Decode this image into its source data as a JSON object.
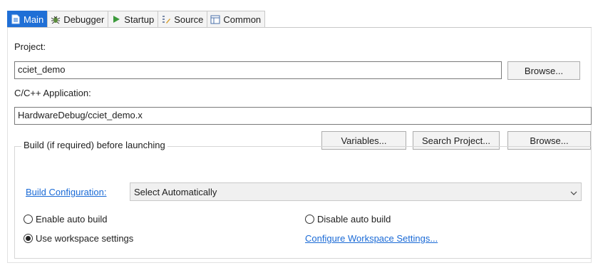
{
  "tabs": [
    {
      "label": "Main",
      "icon": "main-page-icon",
      "active": true
    },
    {
      "label": "Debugger",
      "icon": "debugger-bug-icon",
      "active": false
    },
    {
      "label": "Startup",
      "icon": "startup-play-icon",
      "active": false
    },
    {
      "label": "Source",
      "icon": "source-lookup-icon",
      "active": false
    },
    {
      "label": "Common",
      "icon": "common-window-icon",
      "active": false
    }
  ],
  "project": {
    "label": "Project:",
    "value": "cciet_demo",
    "browse_label": "Browse..."
  },
  "application": {
    "label": "C/C++ Application:",
    "value": "HardwareDebug/cciet_demo.x",
    "variables_label": "Variables...",
    "search_label": "Search Project...",
    "browse_label": "Browse..."
  },
  "build": {
    "group_title": "Build (if required) before launching",
    "config_link": "Build Configuration:",
    "config_value": "Select Automatically",
    "enable_auto": "Enable auto build",
    "disable_auto": "Disable auto build",
    "use_workspace": "Use workspace settings",
    "configure_link": "Configure Workspace Settings...",
    "selected": "use_workspace"
  },
  "colors": {
    "accent": "#1f6fd6",
    "link": "#1a6ad6"
  }
}
